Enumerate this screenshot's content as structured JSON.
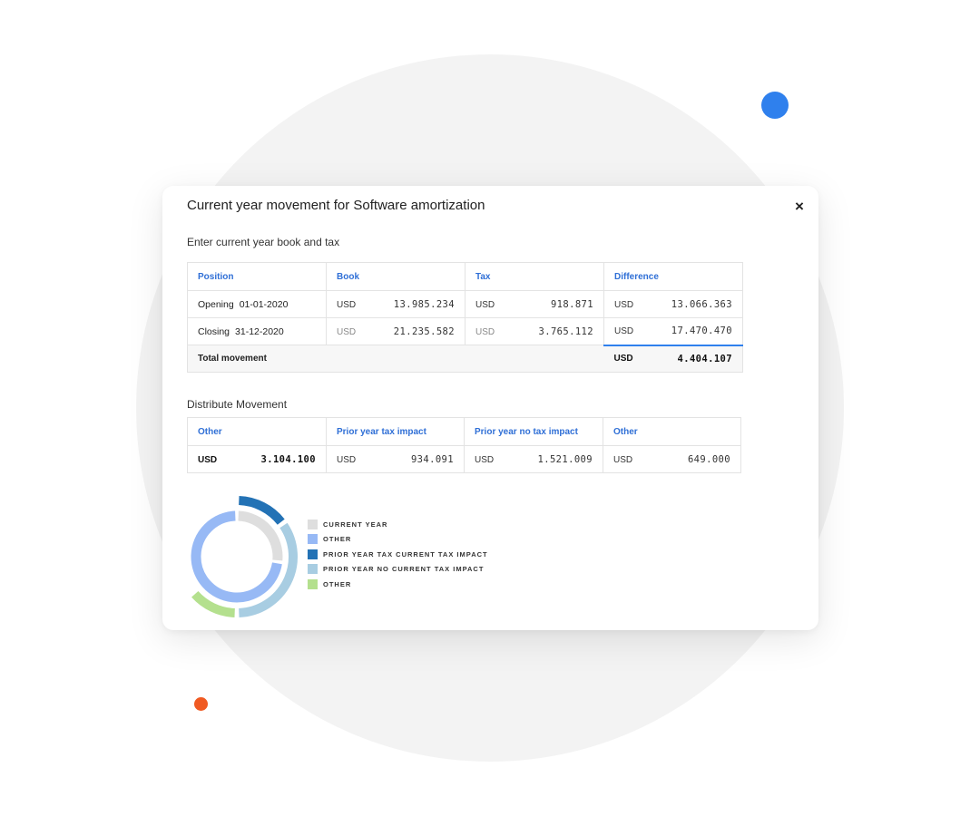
{
  "modal": {
    "title": "Current year movement for Software amortization",
    "close_label": "×"
  },
  "book_tax": {
    "section_label": "Enter current year book and tax",
    "headers": [
      "Position",
      "Book",
      "Tax",
      "Difference"
    ],
    "rows": [
      {
        "position_label": "Opening",
        "position_date": "01-01-2020",
        "book": {
          "currency": "USD",
          "value": "13.985.234"
        },
        "tax": {
          "currency": "USD",
          "value": "918.871"
        },
        "difference": {
          "currency": "USD",
          "value": "13.066.363"
        }
      },
      {
        "position_label": "Closing",
        "position_date": "31-12-2020",
        "book": {
          "currency": "USD",
          "value": "21.235.582"
        },
        "tax": {
          "currency": "USD",
          "value": "3.765.112"
        },
        "difference": {
          "currency": "USD",
          "value": "17.470.470"
        }
      }
    ],
    "total": {
      "label": "Total movement",
      "currency": "USD",
      "value": "4.404.107"
    }
  },
  "distribute": {
    "section_label": "Distribute Movement",
    "headers": [
      "Other",
      "Prior year tax impact",
      "Prior year no tax impact",
      "Other"
    ],
    "values": [
      {
        "currency": "USD",
        "value": "3.104.100"
      },
      {
        "currency": "USD",
        "value": "934.091"
      },
      {
        "currency": "USD",
        "value": "1.521.009"
      },
      {
        "currency": "USD",
        "value": "649.000"
      }
    ]
  },
  "legend": {
    "items": [
      {
        "label": "CURRENT YEAR",
        "color": "#dedede"
      },
      {
        "label": "OTHER",
        "color": "#97b9f5"
      },
      {
        "label": "PRIOR YEAR TAX CURRENT TAX IMPACT",
        "color": "#2372b5"
      },
      {
        "label": "PRIOR YEAR NO CURRENT TAX IMPACT",
        "color": "#a8cde2"
      },
      {
        "label": "OTHER",
        "color": "#b4e08e"
      }
    ]
  },
  "chart_data": {
    "type": "pie",
    "rings": [
      {
        "name": "inner",
        "slices": [
          {
            "label": "CURRENT YEAR",
            "value": 0.27,
            "color": "#dedede"
          },
          {
            "label": "OTHER",
            "value": 0.73,
            "color": "#97b9f5"
          }
        ]
      },
      {
        "name": "outer",
        "slices": [
          {
            "label": "PRIOR YEAR TAX CURRENT TAX IMPACT",
            "value": 0.15,
            "color": "#2372b5"
          },
          {
            "label": "PRIOR YEAR NO CURRENT TAX IMPACT",
            "value": 0.35,
            "color": "#a8cde2"
          },
          {
            "label": "OTHER",
            "value": 0.14,
            "color": "#b4e08e"
          }
        ]
      }
    ]
  },
  "colors": {
    "accent": "#2f80ed",
    "header_text": "#2f6fd6",
    "dot_orange": "#f05a22"
  }
}
